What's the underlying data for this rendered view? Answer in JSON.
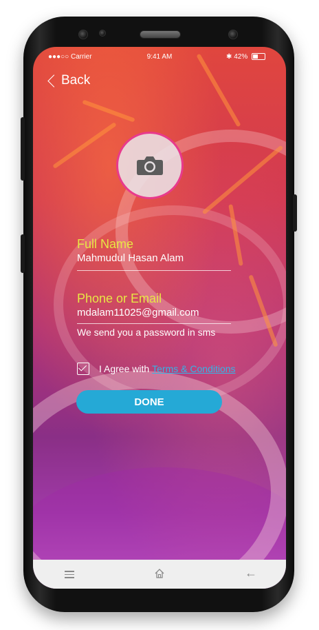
{
  "status_bar": {
    "carrier": "●●●○○ Carrier",
    "time": "9:41 AM",
    "battery_percent": "42%",
    "battery_level": 0.42
  },
  "nav": {
    "back_label": "Back"
  },
  "avatar": {
    "icon": "camera-icon"
  },
  "form": {
    "full_name_label": "Full Name",
    "full_name_value": "Mahmudul Hasan Alam",
    "contact_label": "Phone or Email",
    "contact_value": "mdalam11025@gmail.com",
    "contact_hint": "We send you a password in sms",
    "agree_text": "I Agree with",
    "terms_link": "Terms & Conditions",
    "agree_checked": true,
    "done_button": "DONE"
  },
  "bottom_nav": {
    "back_glyph": "←"
  },
  "colors": {
    "label_yellow": "#e7e645",
    "accent_blue": "#25a9d6",
    "avatar_border": "#e83a8c"
  }
}
